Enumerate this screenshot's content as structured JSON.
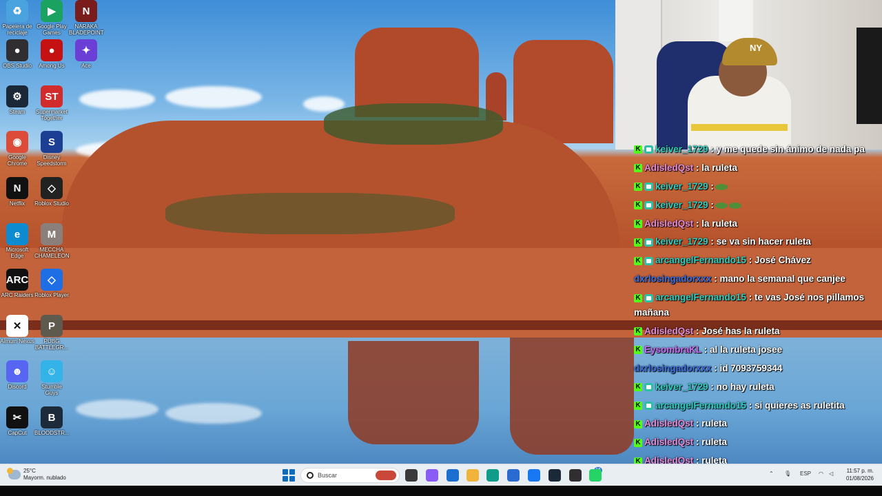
{
  "desktop_icons": [
    {
      "label": "Papelera de reciclaje",
      "icon": "recycle-bin-icon",
      "color": "#4aa3df",
      "glyph": "♻"
    },
    {
      "label": "Google Play Games",
      "icon": "google-play-games-icon",
      "color": "#1aa260",
      "glyph": "▶"
    },
    {
      "label": "NARAKA BLADEPOINT",
      "icon": "naraka-icon",
      "color": "#7a1c1c",
      "glyph": "N"
    },
    {
      "label": "OBS Studio",
      "icon": "obs-icon",
      "color": "#302e31",
      "glyph": "●"
    },
    {
      "label": "Among Us",
      "icon": "among-us-icon",
      "color": "#c51111",
      "glyph": "●"
    },
    {
      "label": "Ace",
      "icon": "ace-icon",
      "color": "#6b3fd6",
      "glyph": "✦"
    },
    {
      "label": "Steam",
      "icon": "steam-icon",
      "color": "#1b2838",
      "glyph": "⚙"
    },
    {
      "label": "Supermarket Together",
      "icon": "supermarket-icon",
      "color": "#d22b2b",
      "glyph": "ST"
    },
    {
      "label": "Google Chrome",
      "icon": "chrome-icon",
      "color": "#dd4b39",
      "glyph": "◉"
    },
    {
      "label": "Disney Speedstorm",
      "icon": "speedstorm-icon",
      "color": "#1c3f94",
      "glyph": "S"
    },
    {
      "label": "Netflix",
      "icon": "netflix-icon",
      "color": "#111111",
      "glyph": "N"
    },
    {
      "label": "Roblox Studio",
      "icon": "roblox-studio-icon",
      "color": "#222222",
      "glyph": "◇"
    },
    {
      "label": "Microsoft Edge",
      "icon": "edge-icon",
      "color": "#0c8bd1",
      "glyph": "e"
    },
    {
      "label": "MECCHA CHAMELEON",
      "icon": "meccha-icon",
      "color": "#8a7f7a",
      "glyph": "M"
    },
    {
      "label": "ARC Raiders",
      "icon": "arc-raiders-icon",
      "color": "#111111",
      "glyph": "ARC"
    },
    {
      "label": "Roblox Player",
      "icon": "roblox-player-icon",
      "color": "#1e6fe6",
      "glyph": "◇"
    },
    {
      "label": "Aimum Nexus",
      "icon": "nexus-icon",
      "color": "#ffffff",
      "glyph": "✕"
    },
    {
      "label": "PUBG BATTLEGR...",
      "icon": "pubg-icon",
      "color": "#5f5a4e",
      "glyph": "P"
    },
    {
      "label": "Discord",
      "icon": "discord-icon",
      "color": "#5865f2",
      "glyph": "☻"
    },
    {
      "label": "Stumble Guys",
      "icon": "stumble-guys-icon",
      "color": "#33b3e8",
      "glyph": "☺"
    },
    {
      "label": "CapCut",
      "icon": "capcut-icon",
      "color": "#111111",
      "glyph": "✂"
    },
    {
      "label": "BLOODSTR...",
      "icon": "bloodstrike-icon",
      "color": "#1c2a3a",
      "glyph": "B"
    }
  ],
  "chat": {
    "messages": [
      {
        "user": "keiver_1729",
        "color": "#2ecfc0",
        "badges": [
          "kick",
          "sub"
        ],
        "text": ": y me quede sin ánimo de nada pa"
      },
      {
        "user": "AdisledQst",
        "color": "#e48ad6",
        "badges": [
          "kick"
        ],
        "text": ": la ruleta"
      },
      {
        "user": "keiver_1729",
        "color": "#2ecfc0",
        "badges": [
          "kick",
          "sub"
        ],
        "text": ":",
        "emotes": 1
      },
      {
        "user": "keiver_1729",
        "color": "#2ecfc0",
        "badges": [
          "kick",
          "sub"
        ],
        "text": ":",
        "emotes": 2
      },
      {
        "user": "AdisledQst",
        "color": "#e48ad6",
        "badges": [
          "kick"
        ],
        "text": ": la ruleta"
      },
      {
        "user": "keiver_1729",
        "color": "#2ecfc0",
        "badges": [
          "kick",
          "sub"
        ],
        "text": ": se va sin hacer ruleta"
      },
      {
        "user": "arcangelFernando15",
        "color": "#2ecfc0",
        "badges": [
          "kick",
          "sub"
        ],
        "text": ": José Chávez"
      },
      {
        "user": "dxrlosingadorxxx",
        "color": "#3b6fe0",
        "badges": [],
        "text": ": mano la semanal que canjee"
      },
      {
        "user": "arcangelFernando15",
        "color": "#2ecfc0",
        "badges": [
          "kick",
          "sub"
        ],
        "text": ": te vas José nos pillamos mañana",
        "wrap": true
      },
      {
        "user": "AdisledQst",
        "color": "#e48ad6",
        "badges": [
          "kick"
        ],
        "text": ": José has la ruleta"
      },
      {
        "user": "EysombraKL",
        "color": "#c86df0",
        "badges": [
          "kick"
        ],
        "text": ": al la ruleta josee"
      },
      {
        "user": "dxrlosingadorxxx",
        "color": "#3b6fe0",
        "badges": [],
        "text": ": id 7093759344"
      },
      {
        "user": "keiver_1729",
        "color": "#2ecfc0",
        "badges": [
          "kick",
          "sub"
        ],
        "text": ": no hay ruleta"
      },
      {
        "user": "arcangelFernando15",
        "color": "#2ecfc0",
        "badges": [
          "kick",
          "sub"
        ],
        "text": ": si quieres as ruletita"
      },
      {
        "user": "AdisledQst",
        "color": "#e48ad6",
        "badges": [
          "kick"
        ],
        "text": ": ruleta"
      },
      {
        "user": "AdisledQst",
        "color": "#e48ad6",
        "badges": [
          "kick"
        ],
        "text": ": ruleta"
      },
      {
        "user": "AdisledQst",
        "color": "#e48ad6",
        "badges": [
          "kick"
        ],
        "text": ": ruleta"
      }
    ]
  },
  "webcam": {
    "cap_logo": "NY"
  },
  "taskbar": {
    "weather_temp": "25°C",
    "weather_desc": "Mayorm. nublado",
    "search_placeholder": "Buscar",
    "apps": [
      {
        "name": "file-explorer-icon",
        "color": "#3a3a3a"
      },
      {
        "name": "copilot-icon",
        "color": "#8a5cf6"
      },
      {
        "name": "outlook-icon",
        "color": "#1c6fd0"
      },
      {
        "name": "folder-icon",
        "color": "#f2b33a"
      },
      {
        "name": "edge-icon",
        "color": "#0f9d8a"
      },
      {
        "name": "store-icon",
        "color": "#2a6bd1"
      },
      {
        "name": "facebook-icon",
        "color": "#1877f2"
      },
      {
        "name": "steam-icon",
        "color": "#1b2838"
      },
      {
        "name": "obs-icon",
        "color": "#302e31"
      },
      {
        "name": "whatsapp-icon",
        "color": "#25d366"
      }
    ],
    "whatsapp_badge": "16",
    "lang": "ESP",
    "time": "11:57 p. m.",
    "date": "01/08/2026"
  }
}
